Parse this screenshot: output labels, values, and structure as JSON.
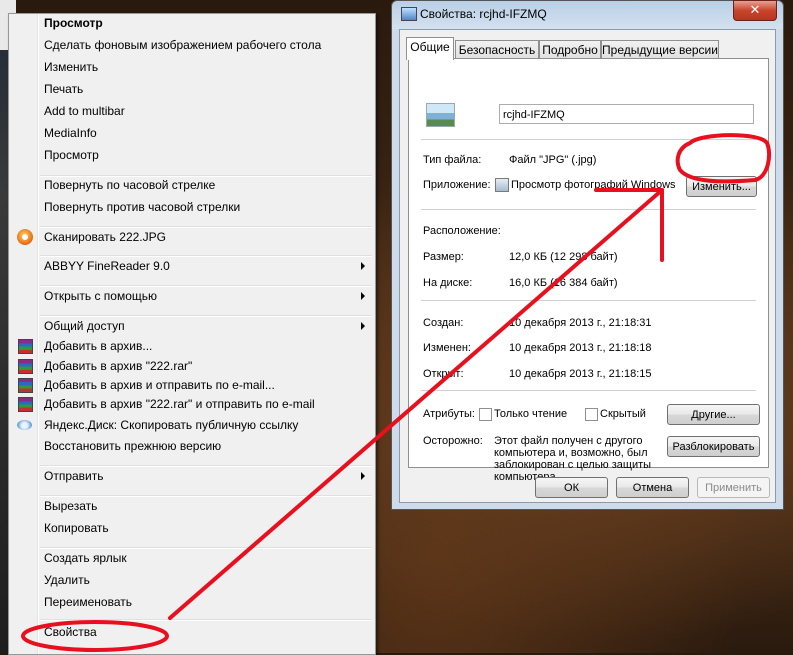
{
  "menu": {
    "items": [
      {
        "label": "Просмотр",
        "bold": true
      },
      {
        "label": "Сделать фоновым изображением рабочего стола"
      },
      {
        "label": "Изменить"
      },
      {
        "label": "Печать"
      },
      {
        "label": "Add to multibar"
      },
      {
        "label": "MediaInfo"
      },
      {
        "label": "Просмотр"
      },
      {
        "label": "Повернуть по часовой стрелке"
      },
      {
        "label": "Повернуть против часовой стрелки"
      },
      {
        "label": "Сканировать 222.JPG",
        "icon": "abbyy-scan-icon"
      },
      {
        "label": "ABBYY FineReader 9.0",
        "submenu": true
      },
      {
        "label": "Открыть с помощью",
        "submenu": true
      },
      {
        "label": "Общий доступ",
        "submenu": true
      },
      {
        "label": "Добавить в архив...",
        "icon": "winrar-icon"
      },
      {
        "label": "Добавить в архив \"222.rar\"",
        "icon": "winrar-icon"
      },
      {
        "label": "Добавить в архив и отправить по e-mail...",
        "icon": "winrar-icon"
      },
      {
        "label": "Добавить в архив \"222.rar\" и отправить по e-mail",
        "icon": "winrar-icon"
      },
      {
        "label": "Яндекс.Диск: Скопировать публичную ссылку",
        "icon": "yandex-disk-icon"
      },
      {
        "label": "Восстановить прежнюю версию"
      },
      {
        "label": "Отправить",
        "submenu": true
      },
      {
        "label": "Вырезать"
      },
      {
        "label": "Копировать"
      },
      {
        "label": "Создать ярлык"
      },
      {
        "label": "Удалить"
      },
      {
        "label": "Переименовать"
      },
      {
        "label": "Свойства"
      }
    ]
  },
  "window": {
    "title": "Свойства: rcjhd-IFZMQ",
    "close_label": "✕",
    "tabs": [
      {
        "label": "Общие"
      },
      {
        "label": "Безопасность"
      },
      {
        "label": "Подробно"
      },
      {
        "label": "Предыдущие версии"
      }
    ],
    "filename": "rcjhd-IFZMQ",
    "filetype_label": "Тип файла:",
    "filetype_value": "Файл \"JPG\" (.jpg)",
    "app_label": "Приложение:",
    "app_value": "Просмотр фотографий Windows",
    "change_button": "Изменить...",
    "location_label": "Расположение:",
    "size_label": "Размер:",
    "size_value": "12,0 КБ (12 298 байт)",
    "disk_label": "На диске:",
    "disk_value": "16,0 КБ (16 384 байт)",
    "created_label": "Создан:",
    "created_value": "10 декабря 2013 г., 21:18:31",
    "modified_label": "Изменен:",
    "modified_value": "10 декабря 2013 г., 21:18:18",
    "opened_label": "Открыт:",
    "opened_value": "10 декабря 2013 г., 21:18:15",
    "attributes_label": "Атрибуты:",
    "readonly_label": "Только чтение",
    "hidden_label": "Скрытый",
    "other_button": "Другие...",
    "caution_label": "Осторожно:",
    "caution_text": [
      "Этот файл получен с другого",
      "компьютера и, возможно, был",
      "заблокирован с целью защиты",
      "компьютера."
    ],
    "unblock_button": "Разблокировать",
    "ok_button": "ОК",
    "cancel_button": "Отмена",
    "apply_button": "Применить"
  },
  "annotation_color": "#e8101e"
}
